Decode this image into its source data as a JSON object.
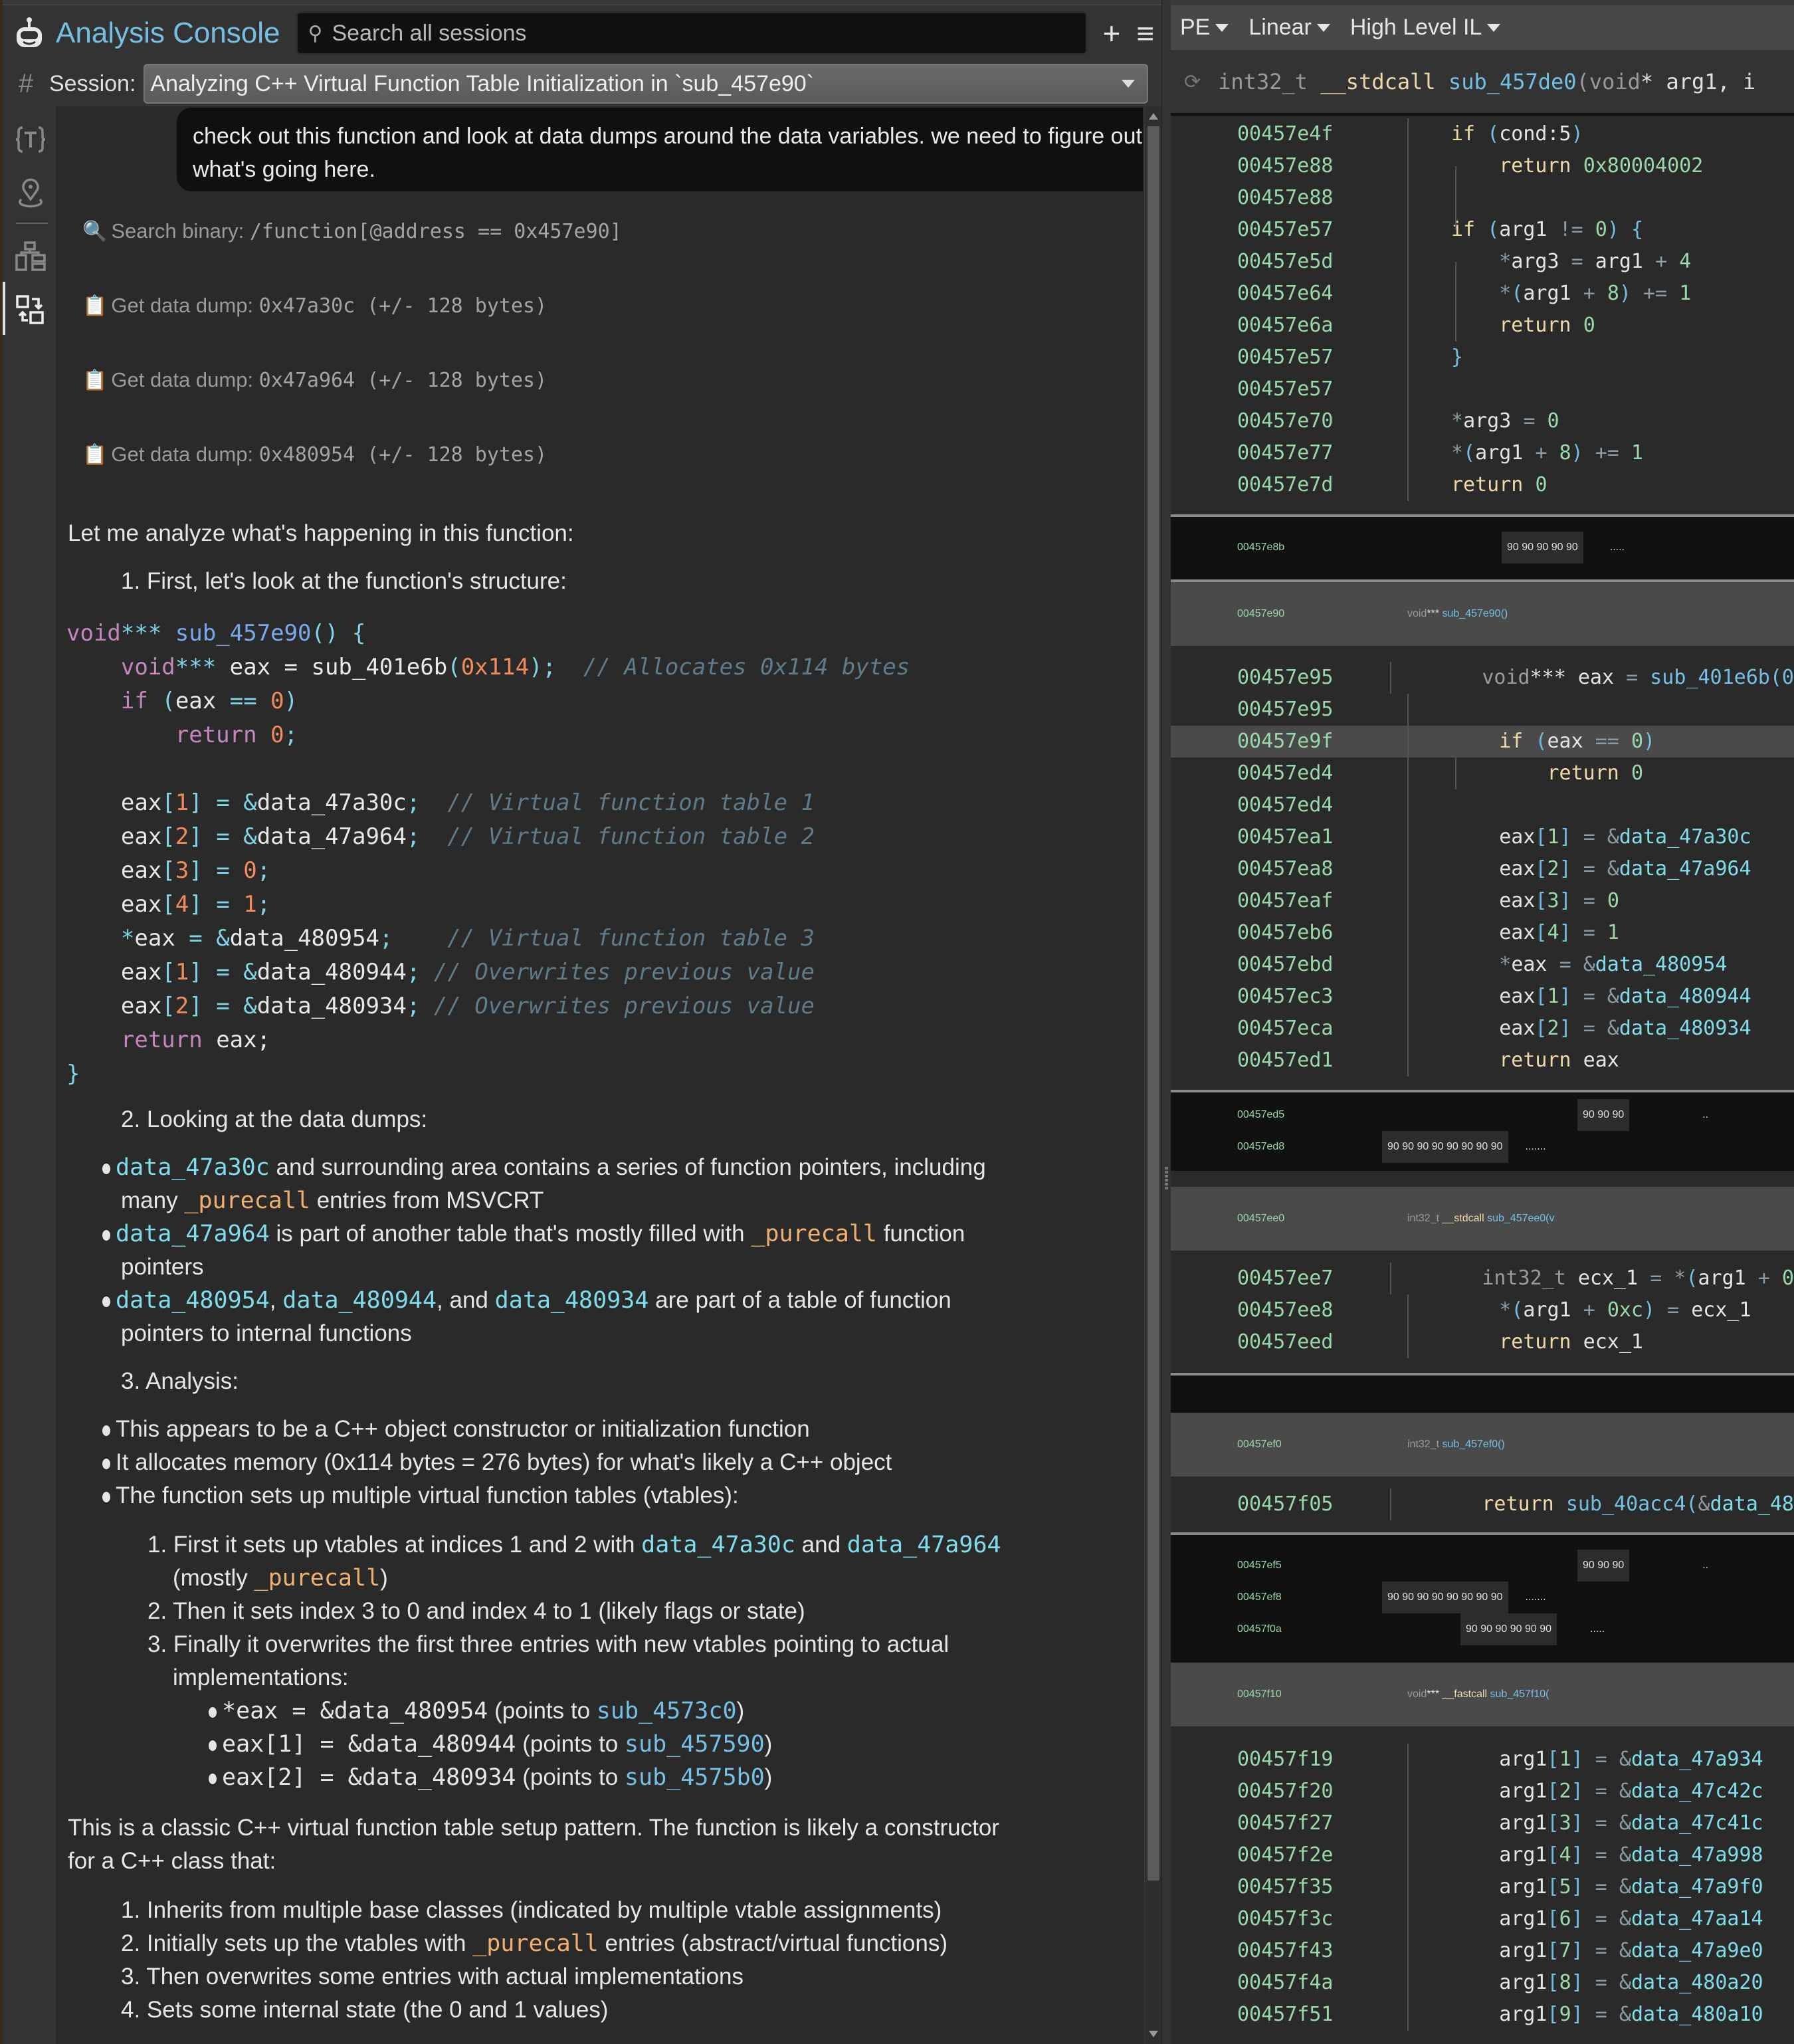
{
  "app": {
    "title": "Analysis Console",
    "search_placeholder": "Search all sessions",
    "new_session_label": "+",
    "menu_label": "≡"
  },
  "session": {
    "label": "Session:",
    "value": "Analyzing C++ Virtual Function Table Initialization in `sub_457e90`"
  },
  "sidebar": {
    "items": [
      {
        "name": "types",
        "icon": "type-braces-icon"
      },
      {
        "name": "location",
        "icon": "map-pin-icon"
      },
      {
        "name": "hierarchy",
        "icon": "hierarchy-icon"
      },
      {
        "name": "cross-references",
        "icon": "swap-icon",
        "active": true
      }
    ]
  },
  "chat": {
    "user_message": "check out this function and look at data dumps around the data variables. we need to figure out what's going here.",
    "tool_calls": [
      {
        "icon": "magnifier-icon",
        "label": "Search binary: ",
        "arg": "/function[@address == 0x457e90]"
      },
      {
        "icon": "clipboard-icon",
        "label": "Get data dump: ",
        "arg": "0x47a30c (+/- 128 bytes)"
      },
      {
        "icon": "clipboard-icon",
        "label": "Get data dump: ",
        "arg": "0x47a964 (+/- 128 bytes)"
      },
      {
        "icon": "clipboard-icon",
        "label": "Get data dump: ",
        "arg": "0x480954 (+/- 128 bytes)"
      }
    ],
    "intro": "Let me analyze what's happening in this function:",
    "step1": "1. First, let's look at the function's structure:",
    "code": {
      "l1_type": "void",
      "l1_ptr": "***",
      "l1_fn": "sub_457e90",
      "l1_rest": "() {",
      "l2_type": "void",
      "l2_ptr": "***",
      "l2_var": " eax = sub_401e6b",
      "l2_num": "0x114",
      "l2_comment": "// Allocates 0x114 bytes",
      "l3_kw": "if",
      "l3_var": "eax",
      "l3_num": "0",
      "l4_kw": "return",
      "l4_num": "0",
      "assign": [
        {
          "lhs": "eax",
          "idx": "1",
          "rhs": "data_47a30c",
          "comment": "// Virtual function table 1"
        },
        {
          "lhs": "eax",
          "idx": "2",
          "rhs": "data_47a964",
          "comment": "// Virtual function table 2"
        },
        {
          "lhs": "eax",
          "idx": "3",
          "num": "0"
        },
        {
          "lhs": "eax",
          "idx": "4",
          "num": "1"
        },
        {
          "lhs": "eax",
          "star": true,
          "rhs": "data_480954",
          "comment": "// Virtual function table 3"
        },
        {
          "lhs": "eax",
          "idx": "1",
          "rhs": "data_480944",
          "comment": "// Overwrites previous value"
        },
        {
          "lhs": "eax",
          "idx": "2",
          "rhs": "data_480934",
          "comment": "// Overwrites previous value"
        }
      ],
      "ret_kw": "return",
      "ret_val": " eax;",
      "close": "}"
    },
    "step2": "2. Looking at the data dumps:",
    "dumps": {
      "b1_sym": "data_47a30c",
      "b1_text": " and surrounding area contains a series of function pointers, including",
      "b1_text2a": "many ",
      "b1_pure": "_purecall",
      "b1_text2b": " entries from MSVCRT",
      "b2_sym": "data_47a964",
      "b2_text": " is part of another table that's mostly filled with ",
      "b2_pure": "_purecall",
      "b2_text_end": " function",
      "b2_text2": "pointers",
      "b3_sym1": "data_480954",
      "b3_sep1": ", ",
      "b3_sym2": "data_480944",
      "b3_sep2": ", and ",
      "b3_sym3": "data_480934",
      "b3_text": " are part of a table of function",
      "b3_text2": "pointers to internal functions"
    },
    "step3": "3. Analysis:",
    "analysis": {
      "a1": "This appears to be a C++ object constructor or initialization function",
      "a2": "It allocates memory (0x114 bytes = 276 bytes) for what's likely a C++ object",
      "a3": "The function sets up multiple virtual function tables (vtables):",
      "s1a": "1. First it sets up vtables at indices 1 and 2 with ",
      "s1_sym1": "data_47a30c",
      "s1_and": " and ",
      "s1_sym2": "data_47a964",
      "s1b_open": "(mostly ",
      "s1b_pure": "_purecall",
      "s1b_close": ")",
      "s2": "2. Then it sets index 3 to 0 and index 4 to 1 (likely flags or state)",
      "s3a": "3. Finally it overwrites the first three entries with new vtables pointing to actual",
      "s3b": "implementations:",
      "impl": [
        {
          "expr": "*eax = &data_480954",
          "pre": " (points to ",
          "target": "sub_4573c0",
          "post": ")"
        },
        {
          "expr": "eax[1] = &data_480944",
          "pre": " (points to ",
          "target": "sub_457590",
          "post": ")"
        },
        {
          "expr": "eax[2] = &data_480934",
          "pre": " (points to ",
          "target": "sub_4575b0",
          "post": ")"
        }
      ]
    },
    "conclusion1": "This is a classic C++ virtual function table setup pattern. The function is likely a constructor",
    "conclusion2": "for a C++ class that:",
    "final_list": [
      "1. Inherits from multiple base classes (indicated by multiple vtable assignments)",
      "2. Initially sets up the vtables with ",
      "3. Then overwrites some entries with actual implementations",
      "4. Sets some internal state (the 0 and 1 values)"
    ],
    "final2_pure": "_purecall",
    "final2_tail": " entries (abstract/virtual functions)"
  },
  "disasm": {
    "toolbar": {
      "arch": "PE",
      "view": "Linear",
      "il": "High Level IL"
    },
    "header": {
      "ret": "int32_t",
      "conv": " __stdcall ",
      "name": "sub_457de0",
      "args": "(void",
      "args2": "* arg1, i"
    },
    "block1": [
      {
        "addr": "00457e4f"
      },
      {
        "addr": "00457e88"
      },
      {
        "addr": "00457e88"
      },
      {
        "addr": "00457e57"
      },
      {
        "addr": "00457e5d"
      },
      {
        "addr": "00457e64"
      },
      {
        "addr": "00457e6a"
      },
      {
        "addr": "00457e57"
      },
      {
        "addr": "00457e57"
      },
      {
        "addr": "00457e70"
      },
      {
        "addr": "00457e77"
      },
      {
        "addr": "00457e7d"
      }
    ],
    "hex1": {
      "addr": "00457e8b",
      "bytes": "90 90 90 90 90",
      "ascii": "....."
    },
    "func2": {
      "addr": "00457e90",
      "ret": "void",
      "ptr": "***",
      "name": " sub_457e90()"
    },
    "block2": [
      {
        "addr": "00457e95"
      },
      {
        "addr": "00457e95"
      },
      {
        "addr": "00457e9f"
      },
      {
        "addr": "00457ed4"
      },
      {
        "addr": "00457ed4"
      },
      {
        "addr": "00457ea1"
      },
      {
        "addr": "00457ea8"
      },
      {
        "addr": "00457eaf"
      },
      {
        "addr": "00457eb6"
      },
      {
        "addr": "00457ebd"
      },
      {
        "addr": "00457ec3"
      },
      {
        "addr": "00457eca"
      },
      {
        "addr": "00457ed1"
      }
    ],
    "hex2": [
      {
        "addr": "00457ed5",
        "bytes": "90 90 90",
        "ascii": ".."
      },
      {
        "addr": "00457ed8",
        "bytes": "90 90 90 90 90 90 90 90",
        "ascii": "......."
      }
    ],
    "func3": {
      "addr": "00457ee0",
      "ret": "int32_t",
      "conv": " __stdcall ",
      "name": "sub_457ee0(v"
    },
    "block3": [
      {
        "addr": "00457ee7"
      },
      {
        "addr": "00457ee8"
      },
      {
        "addr": "00457eed"
      }
    ],
    "func4": {
      "addr": "00457ef0",
      "ret": "int32_t",
      "name": " sub_457ef0()"
    },
    "block4": [
      {
        "addr": "00457f05"
      }
    ],
    "hex3": [
      {
        "addr": "00457ef5",
        "bytes": "90 90 90",
        "ascii": ".."
      },
      {
        "addr": "00457ef8",
        "bytes": "90 90 90 90 90 90 90 90",
        "ascii": "......."
      },
      {
        "addr": "00457f0a",
        "bytes": "90 90 90 90 90 90",
        "ascii": "....."
      }
    ],
    "func5": {
      "addr": "00457f10",
      "ret": "void",
      "ptr": "***",
      "conv": " __fastcall ",
      "name": "sub_457f10("
    },
    "block5": [
      {
        "addr": "00457f19",
        "idx": "1",
        "sym": "data_47a934"
      },
      {
        "addr": "00457f20",
        "idx": "2",
        "sym": "data_47c42c"
      },
      {
        "addr": "00457f27",
        "idx": "3",
        "sym": "data_47c41c"
      },
      {
        "addr": "00457f2e",
        "idx": "4",
        "sym": "data_47a998"
      },
      {
        "addr": "00457f35",
        "idx": "5",
        "sym": "data_47a9f0"
      },
      {
        "addr": "00457f3c",
        "idx": "6",
        "sym": "data_47aa14"
      },
      {
        "addr": "00457f43",
        "idx": "7",
        "sym": "data_47a9e0"
      },
      {
        "addr": "00457f4a",
        "idx": "8",
        "sym": "data_480a20"
      },
      {
        "addr": "00457f51",
        "idx": "9",
        "sym": "data_480a10"
      }
    ]
  }
}
